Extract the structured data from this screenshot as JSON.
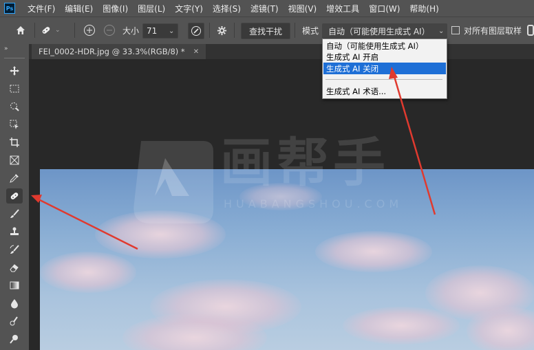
{
  "app": {
    "logo": "Ps"
  },
  "menu": [
    "文件(F)",
    "编辑(E)",
    "图像(I)",
    "图层(L)",
    "文字(Y)",
    "选择(S)",
    "滤镜(T)",
    "视图(V)",
    "增效工具",
    "窗口(W)",
    "帮助(H)"
  ],
  "options": {
    "size_label": "大小",
    "size_value": "71",
    "find_label": "查找干扰",
    "mode_label": "模式",
    "mode_value": "自动（可能使用生成式 AI）",
    "sample_all_label": "对所有图层取样"
  },
  "document": {
    "tab_title": "FEI_0002-HDR.jpg @ 33.3%(RGB/8) *"
  },
  "dropdown": {
    "items": [
      "自动（可能使用生成式 AI）",
      "生成式 AI 开启",
      "生成式 AI 关闭",
      "生成式 AI 术语..."
    ],
    "selected_index": 2
  },
  "tools": [
    "move-tool",
    "marquee-tool",
    "quick-selection-tool",
    "crop-tool",
    "frame-tool",
    "patch-tool",
    "eyedropper-tool",
    "remove-tool",
    "brush-tool",
    "clone-stamp-tool",
    "history-brush-tool",
    "eraser-tool",
    "gradient-tool",
    "blur-tool",
    "smudge-tool",
    "dodge-tool"
  ],
  "watermark": {
    "text": "画帮手",
    "latin": "HUABANGSHOU.COM"
  },
  "colors": {
    "accent": "#1e6fd6",
    "annotation": "#e03a2f"
  }
}
